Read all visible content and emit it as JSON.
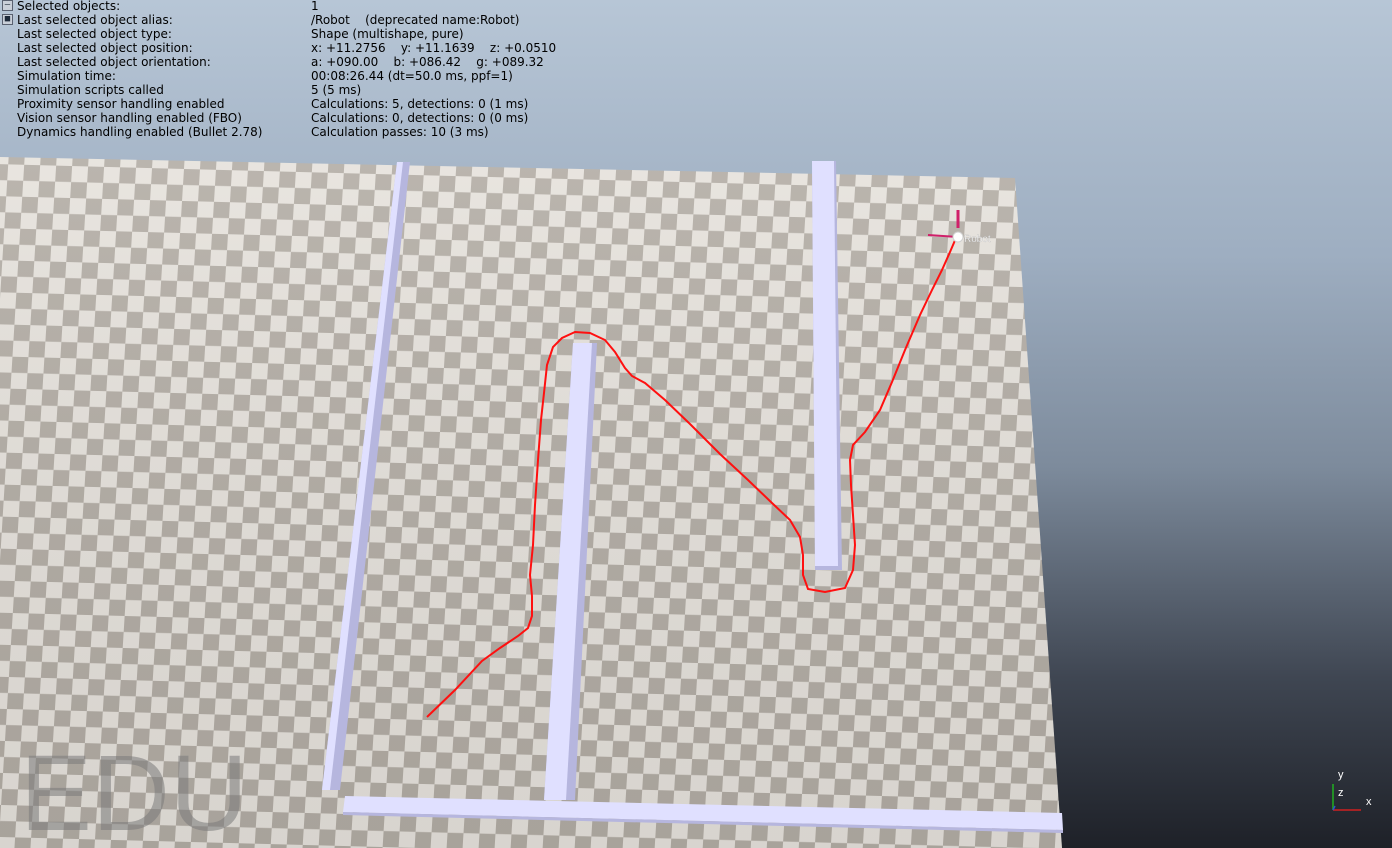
{
  "info_panel": {
    "rows": [
      {
        "label": "Selected objects:",
        "value": "1"
      },
      {
        "label": "Last selected object alias:",
        "value": "/Robot    (deprecated name:Robot)"
      },
      {
        "label": "Last selected object type:",
        "value": "Shape (multishape, pure)"
      },
      {
        "label": "Last selected object position:",
        "value": "x: +11.2756    y: +11.1639    z: +0.0510"
      },
      {
        "label": "Last selected object orientation:",
        "value": "a: +090.00    b: +086.42    g: +089.32"
      },
      {
        "label": "Simulation time:",
        "value": "00:08:26.44 (dt=50.0 ms, ppf=1)"
      },
      {
        "label": "Simulation scripts called",
        "value": "5 (5 ms)"
      },
      {
        "label": "Proximity sensor handling enabled",
        "value": "Calculations: 5, detections: 0 (1 ms)"
      },
      {
        "label": "Vision sensor handling enabled (FBO)",
        "value": "Calculations: 0, detections: 0 (0 ms)"
      },
      {
        "label": "Dynamics handling enabled (Bullet 2.78)",
        "value": "Calculation passes: 10 (3 ms)"
      }
    ],
    "collapse_btn_icon": "minus-icon",
    "toggle_btn_icon": "square-icon"
  },
  "scene": {
    "robot_label": "Robot",
    "watermark": "EDU",
    "axes": {
      "x": "x",
      "y": "y",
      "z": "z"
    }
  },
  "colors": {
    "floor_light": "#e6e2dc",
    "floor_dark": "#b3ada5",
    "wall_top": "#e0e0ff",
    "wall_side": "#b6b6de",
    "path": "#ff1010",
    "robot_marker": "#d0206a",
    "axis_x": "#d02020",
    "axis_y": "#20b020",
    "axis_z": "#3050d0"
  }
}
